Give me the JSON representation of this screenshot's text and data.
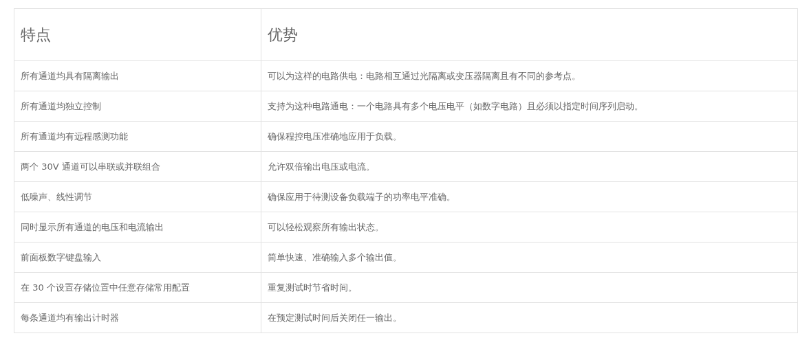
{
  "table": {
    "columns": [
      "特点",
      "优势"
    ],
    "rows": [
      [
        "所有通道均具有隔离输出",
        "可以为这样的电路供电：电路相互通过光隔离或变压器隔离且有不同的参考点。"
      ],
      [
        "所有通道均独立控制",
        "支持为这种电路通电：一个电路具有多个电压电平（如数字电路）且必须以指定时间序列启动。"
      ],
      [
        "所有通道均有远程感测功能",
        "确保程控电压准确地应用于负载。"
      ],
      [
        "两个 30V 通道可以串联或并联组合",
        "允许双倍输出电压或电流。"
      ],
      [
        "低噪声、线性调节",
        "确保应用于待测设备负载端子的功率电平准确。"
      ],
      [
        "同时显示所有通道的电压和电流输出",
        "可以轻松观察所有输出状态。"
      ],
      [
        "前面板数字键盘输入",
        "简单快速、准确输入多个输出值。"
      ],
      [
        "在 30 个设置存储位置中任意存储常用配置",
        "重复测试时节省时间。"
      ],
      [
        "每条通道均有输出计时器",
        "在预定测试时间后关闭任一输出。"
      ]
    ]
  }
}
